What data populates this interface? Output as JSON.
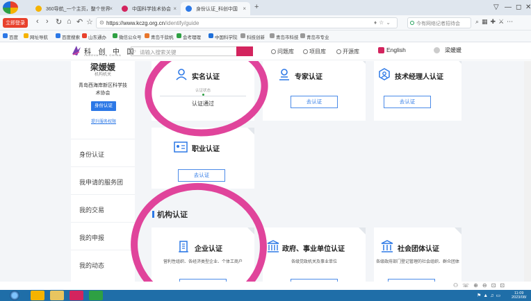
{
  "browser": {
    "tabs": [
      {
        "label": "360导航_一个主页，整个世界"
      },
      {
        "label": "中国科学技术协会"
      },
      {
        "label": "身份认证_科创中国"
      }
    ],
    "login_badge": "立即登录",
    "url_host": "https://www.kczg.org.cn",
    "url_path": "/identify/guide",
    "search_placeholder": "今有网络记者招待会",
    "bookmarks": [
      "百度",
      "网址导航",
      "百度搜索",
      "山东通办",
      "微信公众号",
      "青岛千牍帆",
      "会考理理",
      "中国科学院",
      "科技创新",
      "青岛市科技",
      "青岛市专业"
    ]
  },
  "site": {
    "logo_text": "科 创 中 国",
    "logo_sub": "INNOVATION CHINA",
    "search_placeholder": "请输入搜索关键",
    "nav": [
      "问题库",
      "项目库",
      "开源库"
    ],
    "lang": "English",
    "user": "梁媛媛"
  },
  "sidebar": {
    "org_title": "梁媛媛",
    "org_subtitle": "机构机关",
    "org_name": "青岛西海岸新区科学技术协会",
    "cert_button": "身份认证",
    "upgrade_link": "提升服务权限",
    "menu": [
      {
        "label": "身份认证"
      },
      {
        "label": "我申请的服务团"
      },
      {
        "label": "我的交易"
      },
      {
        "label": "我的申报"
      },
      {
        "label": "我的动态"
      }
    ]
  },
  "cards": {
    "realname": {
      "title": "实名认证",
      "status_label": "认证状态",
      "status_value": "认证通过"
    },
    "expert": {
      "title": "专家认证",
      "button": "去认证"
    },
    "tech_manager": {
      "title": "技术经理人认证",
      "button": "去认证"
    },
    "occupation": {
      "title": "职业认证",
      "button": "去认证"
    },
    "section_title": "机构认证",
    "enterprise": {
      "title": "企业认证",
      "desc": "营利性组织、各经济类型企业、个体工商户"
    },
    "government": {
      "title": "政府、事业单位认证",
      "desc": "各级党政机关及事业单位"
    },
    "social": {
      "title": "社会团体认证",
      "desc": "各级政府部门登记管理的社会组织、群众团体"
    }
  },
  "taskbar": {
    "clock_time": "11:09",
    "clock_date": "2023/08/"
  },
  "colors": {
    "accent_blue": "#2c78e6",
    "brand_pink": "#d3245e",
    "annotation_pink": "#e0449b",
    "verified_green": "#4caf50"
  }
}
